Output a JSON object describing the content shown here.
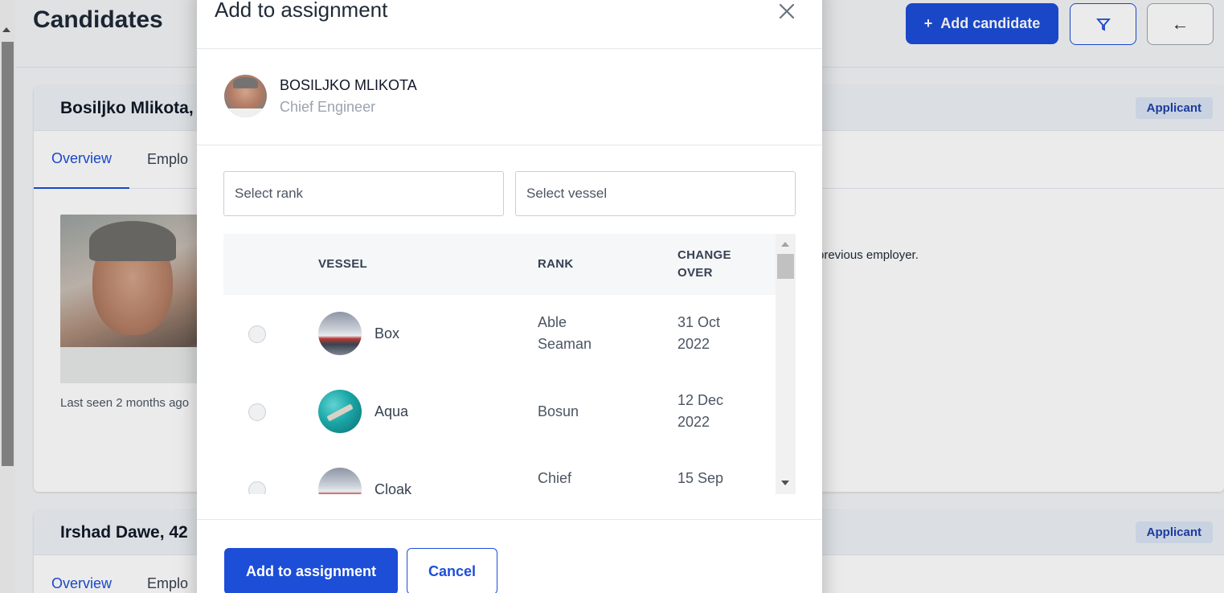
{
  "page": {
    "title": "Candidates",
    "add_candidate_label": "Add candidate",
    "filter_icon": "filter-icon",
    "back_icon": "arrow-left-icon",
    "cards": [
      {
        "name": "Bosiljko Mlikota,",
        "badge": "Applicant",
        "tabs": [
          "Overview",
          "Emplo"
        ],
        "last_seen": "Last seen 2 months ago",
        "text": "previous employer."
      },
      {
        "name": "Irshad Dawe, 42",
        "badge": "Applicant",
        "tabs": [
          "Overview",
          "Emplo"
        ]
      }
    ]
  },
  "modal": {
    "title": "Add to assignment",
    "close_icon": "close-icon",
    "candidate": {
      "name": "BOSILJKO MLIKOTA",
      "role": "Chief Engineer"
    },
    "rank_placeholder": "Select rank",
    "vessel_placeholder": "Select vessel",
    "table": {
      "headers": {
        "vessel": "VESSEL",
        "rank": "RANK",
        "change_line1": "CHANGE",
        "change_line2": "OVER"
      },
      "rows": [
        {
          "vessel": "Box",
          "rank_line1": "Able",
          "rank_line2": "Seaman",
          "date_line1": "31 Oct",
          "date_line2": "2022"
        },
        {
          "vessel": "Aqua",
          "rank_line1": "Bosun",
          "rank_line2": "",
          "date_line1": "12 Dec",
          "date_line2": "2022"
        },
        {
          "vessel": "Cloak",
          "rank_line1": "Chief",
          "rank_line2": "",
          "date_line1": "15 Sep",
          "date_line2": ""
        }
      ]
    },
    "primary_button": "Add to assignment",
    "cancel_button": "Cancel"
  },
  "colors": {
    "accent": "#1d4ed8",
    "badge_bg": "#dbe4f3",
    "header_bg": "#f6f7f9"
  }
}
